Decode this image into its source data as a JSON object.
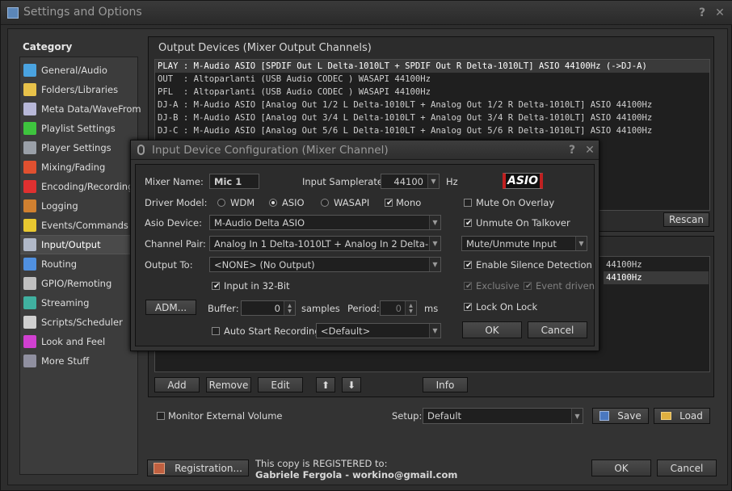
{
  "window": {
    "title": "Settings and Options",
    "help": "?",
    "close": "✕"
  },
  "category": {
    "label": "Category",
    "items": [
      {
        "label": "General/Audio",
        "icon": "music-note-icon",
        "color": "#4aa3e0"
      },
      {
        "label": "Folders/Libraries",
        "icon": "folder-icon",
        "color": "#e8c24a"
      },
      {
        "label": "Meta Data/WaveFrom",
        "icon": "tags-icon",
        "color": "#b8b8d8"
      },
      {
        "label": "Playlist Settings",
        "icon": "playlist-play-icon",
        "color": "#3ec43e"
      },
      {
        "label": "Player Settings",
        "icon": "player-icon",
        "color": "#9aa0a8"
      },
      {
        "label": "Mixing/Fading",
        "icon": "crossfade-icon",
        "color": "#e05030"
      },
      {
        "label": "Encoding/Recording",
        "icon": "record-icon",
        "color": "#e03030"
      },
      {
        "label": "Logging",
        "icon": "log-book-icon",
        "color": "#d08030"
      },
      {
        "label": "Events/Commands",
        "icon": "lightning-icon",
        "color": "#e8c830"
      },
      {
        "label": "Input/Output",
        "icon": "input-output-icon",
        "color": "#b0b8c8"
      },
      {
        "label": "Routing",
        "icon": "routing-icon",
        "color": "#5090e0"
      },
      {
        "label": "GPIO/Remoting",
        "icon": "gpio-icon",
        "color": "#c0c0c0"
      },
      {
        "label": "Streaming",
        "icon": "streaming-icon",
        "color": "#40b0a0"
      },
      {
        "label": "Scripts/Scheduler",
        "icon": "clock-icon",
        "color": "#d0d0d0"
      },
      {
        "label": "Look and Feel",
        "icon": "palette-icon",
        "color": "#d040d0"
      },
      {
        "label": "More Stuff",
        "icon": "more-stuff-icon",
        "color": "#9090a0"
      }
    ],
    "selected_index": 9
  },
  "output_devices": {
    "title": "Output Devices (Mixer Output Channels)",
    "rows": [
      "PLAY : M-Audio ASIO [SPDIF Out L Delta-1010LT + SPDIF Out R Delta-1010LT] ASIO 44100Hz (->DJ-A)",
      "OUT  : Altoparlanti (USB Audio CODEC ) WASAPI 44100Hz",
      "PFL  : Altoparlanti (USB Audio CODEC ) WASAPI 44100Hz",
      "DJ-A : M-Audio ASIO [Analog Out 1/2 L Delta-1010LT + Analog Out 1/2 R Delta-1010LT] ASIO 44100Hz",
      "DJ-B : M-Audio ASIO [Analog Out 3/4 L Delta-1010LT + Analog Out 3/4 R Delta-1010LT] ASIO 44100Hz",
      "DJ-C : M-Audio ASIO [Analog Out 5/6 L Delta-1010LT + Analog Out 5/6 R Delta-1010LT] ASIO 44100Hz"
    ],
    "rescan": "Rescan"
  },
  "input_devices": {
    "rows": [
      "44100Hz",
      "44100Hz"
    ],
    "buttons": {
      "add": "Add",
      "remove": "Remove",
      "edit": "Edit",
      "up": "⬆",
      "down": "⬇",
      "info": "Info"
    }
  },
  "footer": {
    "monitor_external_volume": "Monitor External Volume",
    "setup_label": "Setup:",
    "setup_value": "Default",
    "save": "Save",
    "load": "Load",
    "registration": "Registration...",
    "registered_line": "This copy is REGISTERED to:",
    "registered_user": "Gabriele Fergola - workino@gmail.com",
    "ok": "OK",
    "cancel": "Cancel"
  },
  "dialog": {
    "title": "Input Device Configuration (Mixer Channel)",
    "help": "?",
    "close": "✕",
    "mixer_name_label": "Mixer Name:",
    "mixer_name_value": "Mic 1",
    "samplerate_label": "Input Samplerate:",
    "samplerate_value": "44100",
    "samplerate_unit": "Hz",
    "asio_logo": "ASIO",
    "driver_model_label": "Driver Model:",
    "driver_wdm": "WDM",
    "driver_asio": "ASIO",
    "driver_wasapi": "WASAPI",
    "mono": "Mono",
    "mute_on_overlay": "Mute On Overlay",
    "asio_device_label": "Asio Device:",
    "asio_device_value": "M-Audio Delta ASIO",
    "unmute_on_talkover": "Unmute On Talkover",
    "channel_pair_label": "Channel Pair:",
    "channel_pair_value": "Analog In 1 Delta-1010LT + Analog In 2 Delta-1010LT",
    "mute_mode_value": "Mute/Unmute Input",
    "output_to_label": "Output To:",
    "output_to_value": "<NONE> (No Output)",
    "enable_silence_detection": "Enable Silence Detection",
    "input_32bit": "Input in 32-Bit",
    "exclusive": "Exclusive",
    "event_driven": "Event driven",
    "adm_button": "ADM...",
    "buffer_label": "Buffer:",
    "buffer_value": "0",
    "buffer_unit": "samples",
    "period_label": "Period:",
    "period_value": "0",
    "period_unit": "ms",
    "lock_on_lock": "Lock On Lock",
    "auto_start_recording": "Auto Start Recording",
    "recording_value": "<Default>",
    "ok": "OK",
    "cancel": "Cancel"
  }
}
